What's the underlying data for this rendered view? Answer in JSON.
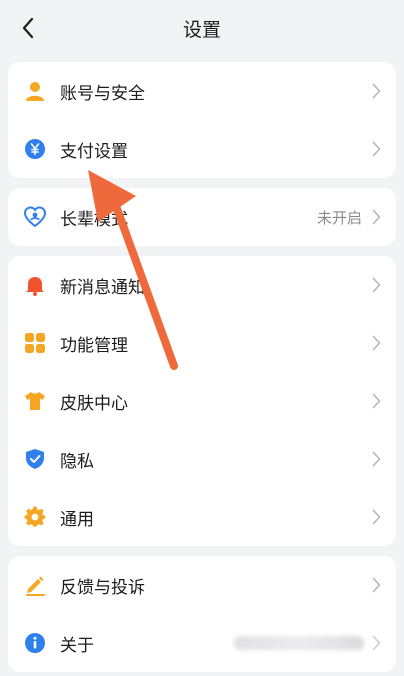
{
  "header": {
    "title": "设置",
    "back_icon": "chevron-left-icon"
  },
  "groups": [
    {
      "items": [
        {
          "label": "账号与安全",
          "icon": "user-icon",
          "icon_color": "#f5a623"
        },
        {
          "label": "支付设置",
          "icon": "yuan-coin-icon",
          "icon_color": "#2f80ed"
        }
      ]
    },
    {
      "items": [
        {
          "label": "长辈模式",
          "icon": "heart-care-icon",
          "icon_color": "#2f80ed",
          "value": "未开启"
        }
      ]
    },
    {
      "items": [
        {
          "label": "新消息通知",
          "icon": "bell-icon",
          "icon_color": "#f0532d"
        },
        {
          "label": "功能管理",
          "icon": "grid-icon",
          "icon_color": "#f5a623"
        },
        {
          "label": "皮肤中心",
          "icon": "tshirt-icon",
          "icon_color": "#f5a623"
        },
        {
          "label": "隐私",
          "icon": "shield-check-icon",
          "icon_color": "#2f80ed"
        },
        {
          "label": "通用",
          "icon": "gear-icon",
          "icon_color": "#f5a623"
        }
      ]
    },
    {
      "items": [
        {
          "label": "反馈与投诉",
          "icon": "pencil-icon",
          "icon_color": "#f5a623"
        },
        {
          "label": "关于",
          "icon": "info-icon",
          "icon_color": "#2f80ed"
        }
      ]
    }
  ],
  "annotation": {
    "arrow_color": "#ee6a3c",
    "points_to": "支付设置"
  }
}
